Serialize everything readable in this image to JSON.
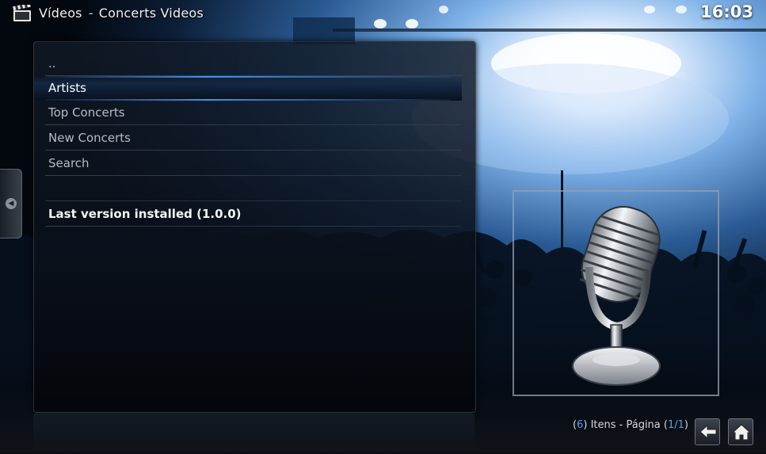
{
  "header": {
    "section": "Vídeos",
    "separator": "-",
    "addon_title": "Concerts Videos",
    "clock": "16:03"
  },
  "list": {
    "items": [
      {
        "label": "..",
        "selected": false,
        "bold": false
      },
      {
        "label": "Artists",
        "selected": true,
        "bold": false
      },
      {
        "label": "Top Concerts",
        "selected": false,
        "bold": false
      },
      {
        "label": "New Concerts",
        "selected": false,
        "bold": false
      },
      {
        "label": "Search",
        "selected": false,
        "bold": false
      },
      {
        "label": "",
        "selected": false,
        "bold": false
      },
      {
        "label": "Last version installed (1.0.0)",
        "selected": false,
        "bold": true
      }
    ]
  },
  "footer": {
    "count_open": "(",
    "count": "6",
    "count_close": ")",
    "items_label": " Itens - Página ",
    "page_open": "(",
    "page": "1",
    "page_sep": "/",
    "pages": "1",
    "page_close": ")"
  },
  "icons": {
    "header": "film-clapper-icon",
    "thumbnail": "microphone-icon",
    "back": "back-arrow-icon",
    "home": "home-icon",
    "side": "side-menu-icon"
  },
  "colors": {
    "accent": "#4aa0ff",
    "selected_bar": "#1e4a80"
  }
}
